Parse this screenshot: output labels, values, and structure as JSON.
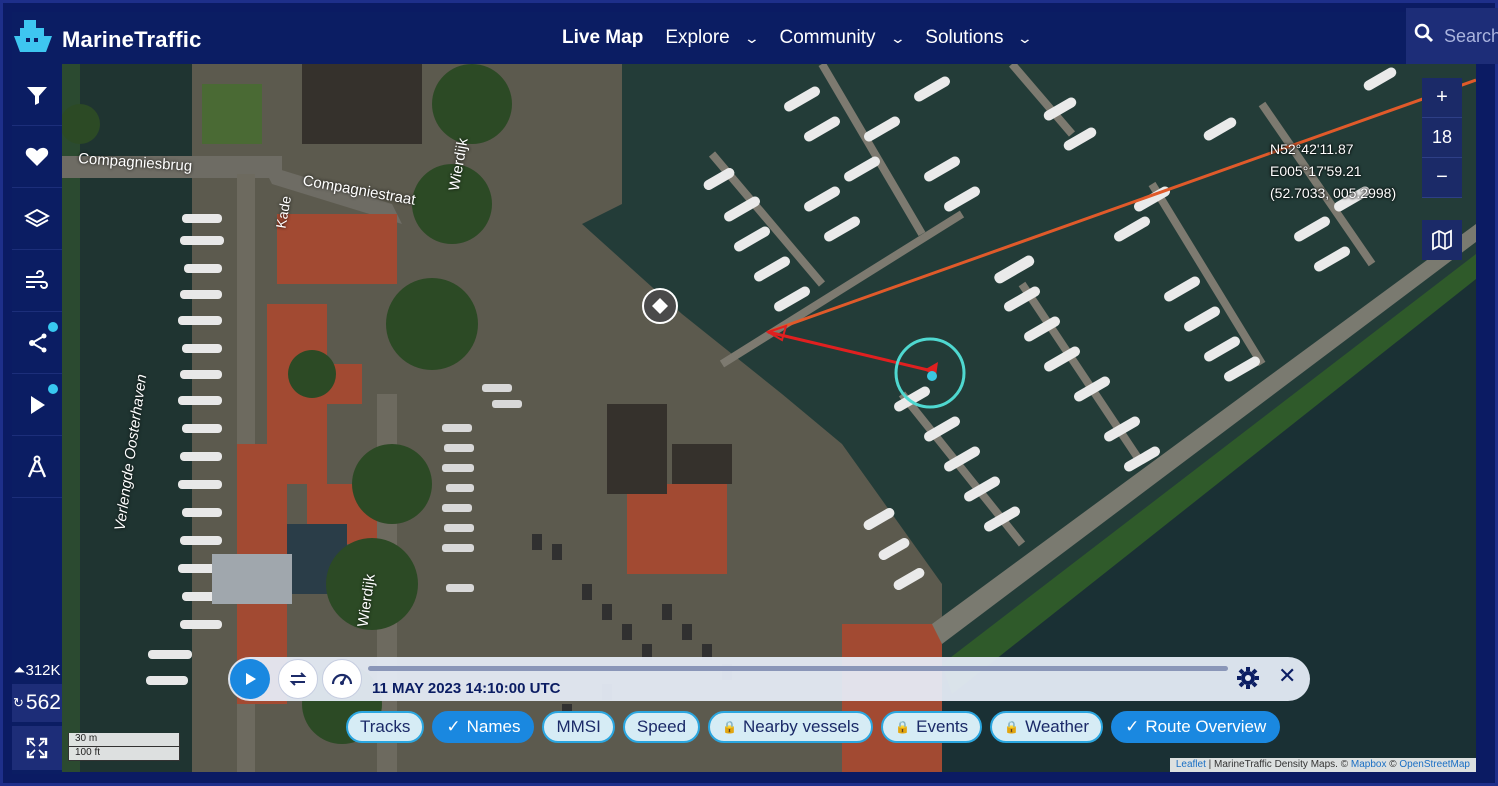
{
  "brand": {
    "name": "MarineTraffic",
    "logo_icon": "ship-logo-icon"
  },
  "nav": {
    "items": [
      {
        "label": "Live Map",
        "active": true
      },
      {
        "label": "Explore"
      },
      {
        "label": "Community"
      },
      {
        "label": "Solutions"
      }
    ],
    "search_placeholder": "Search"
  },
  "sidebar": {
    "items": [
      {
        "icon": "filter-icon"
      },
      {
        "icon": "heart-icon"
      },
      {
        "icon": "layers-icon"
      },
      {
        "icon": "wind-icon"
      },
      {
        "icon": "network-icon",
        "badge": true
      },
      {
        "icon": "play-icon",
        "badge": true
      },
      {
        "icon": "compass-icon"
      }
    ],
    "vessel_count_small": "312K",
    "vessel_count_big": "562"
  },
  "map": {
    "labels": {
      "compagniesbrug": "Compagniesbrug",
      "compagniestraat": "Compagniestraat",
      "kade": "Kade",
      "wierdijk_top": "Wierdijk",
      "oosterhaven": "Verlengde Oosterhaven",
      "wierdijk_bottom": "Wierdijk"
    },
    "coordinates": {
      "lat": "N52°42'11.87",
      "lon": "E005°17'59.21",
      "decimal": "(52.7033, 005.2998)"
    },
    "zoom": {
      "plus": "+",
      "level": "18",
      "minus": "−"
    },
    "scale": {
      "metric": "30 m",
      "imperial": "100 ft"
    },
    "attribution": {
      "leaflet": "Leaflet",
      "text": " | MarineTraffic Density Maps. © ",
      "mapbox": "Mapbox",
      "sep": " © ",
      "osm": "OpenStreetMap"
    }
  },
  "playback": {
    "date": "11 MAY 2023 14:10:00 UTC",
    "progress": 0
  },
  "chips": [
    {
      "label": "Tracks",
      "state": "off"
    },
    {
      "label": "Names",
      "state": "on"
    },
    {
      "label": "MMSI",
      "state": "off"
    },
    {
      "label": "Speed",
      "state": "off"
    },
    {
      "label": "Nearby vessels",
      "state": "locked"
    },
    {
      "label": "Events",
      "state": "locked"
    },
    {
      "label": "Weather",
      "state": "locked"
    },
    {
      "label": "Route Overview",
      "state": "on"
    }
  ],
  "colors": {
    "navy": "#0b1d63",
    "accent_blue": "#1a88e0",
    "route_red": "#e02020",
    "vessel_ring": "#4fd8d0"
  }
}
